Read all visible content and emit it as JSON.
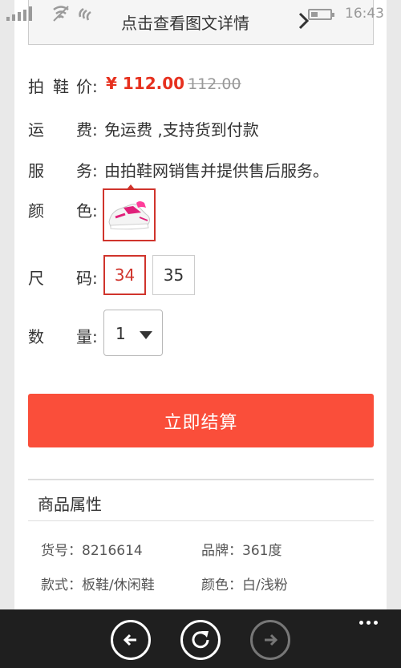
{
  "status_bar": {
    "time": "16:43"
  },
  "detail_link": {
    "label": "点击查看图文详情"
  },
  "product": {
    "price_label_1": "拍",
    "price_label_2": "鞋",
    "price_label_3": "价:",
    "price_now": "¥ 112.00",
    "price_old": "112.00",
    "shipping_label_1": "运",
    "shipping_label_2": "费:",
    "shipping_value": "免运费 ,支持货到付款",
    "service_label_1": "服",
    "service_label_2": "务:",
    "service_value": "由拍鞋网销售并提供售后服务。",
    "color_label_1": "颜",
    "color_label_2": "色:",
    "size_label_1": "尺",
    "size_label_2": "码:",
    "sizes": [
      "34",
      "35"
    ],
    "selected_size": "34",
    "qty_label_1": "数",
    "qty_label_2": "量:",
    "quantity": "1"
  },
  "buy_button": {
    "label": "立即结算"
  },
  "attributes": {
    "title": "商品属性",
    "item_no": "货号：8216614",
    "brand": "品牌：361度",
    "style": "款式：板鞋/休闲鞋",
    "color": "颜色：白/浅粉"
  },
  "colors": {
    "accent": "#fa4e3a",
    "price": "#e6301e",
    "selected_border": "#d0342c",
    "appbar": "#1f1f1f"
  },
  "icons": {
    "back": "back-arrow-icon",
    "refresh": "refresh-icon",
    "forward": "forward-arrow-icon",
    "more": "more-dots-icon"
  }
}
